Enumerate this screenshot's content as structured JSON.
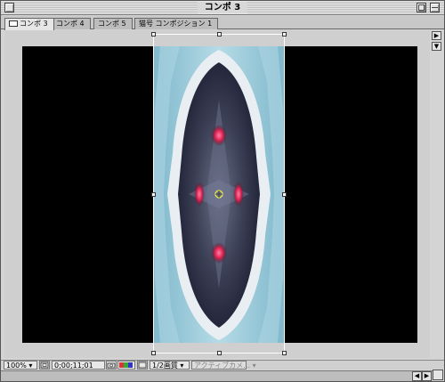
{
  "window": {
    "title": "コンポ 3"
  },
  "tabs": [
    {
      "label": "コンポ 3"
    },
    {
      "label": "コンポ 4"
    },
    {
      "label": "コンポ 5"
    },
    {
      "label": "猫号 コンポジション 1"
    }
  ],
  "status": {
    "zoom": "100%",
    "timecode": "0;00;11;01",
    "resolution": "1/2画質",
    "camera": "アクティブカメ…"
  },
  "colors": {
    "composition_background": "#000000",
    "frame_accent": "#ffffff",
    "image_highlight": "#e0204f",
    "image_edge": "#8fc6d8"
  },
  "icons": [
    "close-icon",
    "zoom-icon",
    "collapse-icon",
    "comp-tab-icon",
    "triangle-right-icon",
    "triangle-down-icon",
    "safe-zones-icon",
    "snapshot-icon",
    "channels-icon",
    "region-icon",
    "anchor-point-icon"
  ]
}
